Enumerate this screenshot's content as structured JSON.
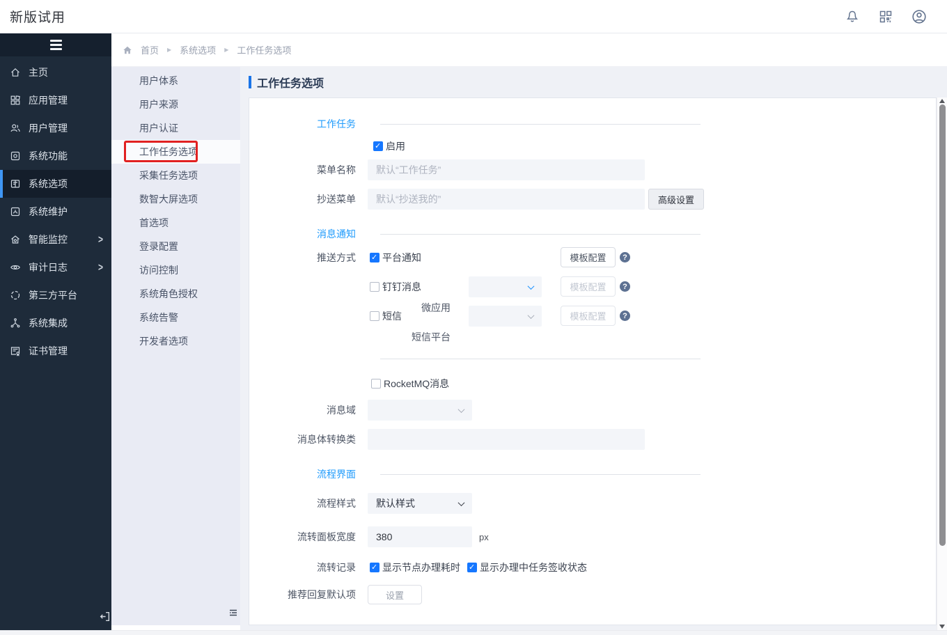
{
  "header": {
    "logo": "新版试用"
  },
  "nav": {
    "items": [
      {
        "label": "主页"
      },
      {
        "label": "应用管理"
      },
      {
        "label": "用户管理"
      },
      {
        "label": "系统功能"
      },
      {
        "label": "系统选项",
        "selected": true
      },
      {
        "label": "系统维护"
      },
      {
        "label": "智能监控",
        "expandable": true
      },
      {
        "label": "审计日志",
        "expandable": true
      },
      {
        "label": "第三方平台"
      },
      {
        "label": "系统集成"
      },
      {
        "label": "证书管理"
      }
    ]
  },
  "breadcrumb": {
    "home": "首页",
    "level1": "系统选项",
    "level2": "工作任务选项"
  },
  "submenu": {
    "items": [
      {
        "label": "用户体系"
      },
      {
        "label": "用户来源"
      },
      {
        "label": "用户认证"
      },
      {
        "label": "工作任务选项",
        "selected": true,
        "annotated": true
      },
      {
        "label": "采集任务选项"
      },
      {
        "label": "数智大屏选项"
      },
      {
        "label": "首选项"
      },
      {
        "label": "登录配置"
      },
      {
        "label": "访问控制"
      },
      {
        "label": "系统角色授权"
      },
      {
        "label": "系统告警"
      },
      {
        "label": "开发者选项"
      }
    ]
  },
  "page": {
    "title": "工作任务选项"
  },
  "form": {
    "sections": {
      "work_task": "工作任务",
      "notification": "消息通知",
      "flow_ui": "流程界面"
    },
    "enable": {
      "label": "启用",
      "checked": true
    },
    "menu_name": {
      "label": "菜单名称",
      "placeholder": "默认“工作任务”",
      "value": ""
    },
    "cc_menu": {
      "label": "抄送菜单",
      "placeholder": "默认“抄送我的”",
      "value": "",
      "advanced_button": "高级设置"
    },
    "push_mode": {
      "label": "推送方式",
      "platform": {
        "label": "平台通知",
        "checked": true,
        "template_button": "模板配置"
      },
      "dingtalk": {
        "label": "钉钉消息",
        "checked": false,
        "micro_app_label": "微应用",
        "selected_app": "",
        "template_button": "模板配置"
      },
      "sms": {
        "label": "短信",
        "checked": false,
        "platform_label": "短信平台",
        "selected_platform": "",
        "template_button": "模板配置"
      }
    },
    "rocketmq": {
      "label": "RocketMQ消息",
      "checked": false
    },
    "message_domain": {
      "label": "消息域",
      "value": ""
    },
    "message_converter": {
      "label": "消息体转换类",
      "value": ""
    },
    "flow_style": {
      "label": "流程样式",
      "value": "默认样式"
    },
    "panel_width": {
      "label": "流转面板宽度",
      "value": "380",
      "unit": "px"
    },
    "flow_record": {
      "label": "流转记录",
      "options": [
        {
          "label": "显示节点办理耗时",
          "checked": true
        },
        {
          "label": "显示办理中任务签收状态",
          "checked": true
        }
      ]
    },
    "recommend_reply": {
      "label": "推荐回复默认项",
      "button": "设置"
    }
  },
  "colors": {
    "accent_blue": "#1a74e8",
    "section_blue": "#1f9bfc",
    "checkbox_blue": "#1677ff",
    "annotation_red": "#e12121",
    "sidebar_dark": "#1e2b3a",
    "submenu_bg": "#e9ebf4"
  }
}
